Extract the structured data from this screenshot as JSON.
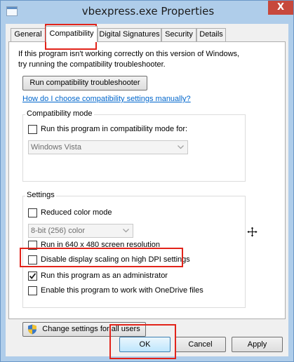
{
  "window": {
    "title": "vbexpress.exe Properties",
    "close_glyph": "X",
    "app_icon": "window-app-icon"
  },
  "tabs": [
    {
      "label": "General"
    },
    {
      "label": "Compatibility",
      "selected": true
    },
    {
      "label": "Digital Signatures"
    },
    {
      "label": "Security"
    },
    {
      "label": "Details"
    }
  ],
  "intro": {
    "line1": "If this program isn't working correctly on this version of Windows,",
    "line2": "try running the compatibility troubleshooter."
  },
  "troubleshooter_button": "Run compatibility troubleshooter",
  "help_link": "How do I choose compatibility settings manually?",
  "compatibility_mode": {
    "group_label": "Compatibility mode",
    "checkbox_label": "Run this program in compatibility mode for:",
    "checked": false,
    "select_value": "Windows Vista",
    "select_enabled": false
  },
  "settings": {
    "group_label": "Settings",
    "reduced_color": {
      "label": "Reduced color mode",
      "checked": false
    },
    "color_select_value": "8-bit (256) color",
    "run_640": {
      "label": "Run in 640 x 480 screen resolution",
      "checked": false
    },
    "disable_dpi": {
      "label": "Disable display scaling on high DPI settings",
      "checked": false
    },
    "run_admin": {
      "label": "Run this program as an administrator",
      "checked": true
    },
    "onedrive": {
      "label": "Enable this program to work with OneDrive files",
      "checked": false
    }
  },
  "change_settings_button": "Change settings for all users",
  "footer": {
    "ok_label": "OK",
    "cancel_label": "Cancel",
    "apply_label": "Apply"
  },
  "colors": {
    "title_bar": "#afcdea",
    "close_button": "#c7483c",
    "highlight_red": "#e2231a",
    "link_blue": "#0066cc"
  }
}
